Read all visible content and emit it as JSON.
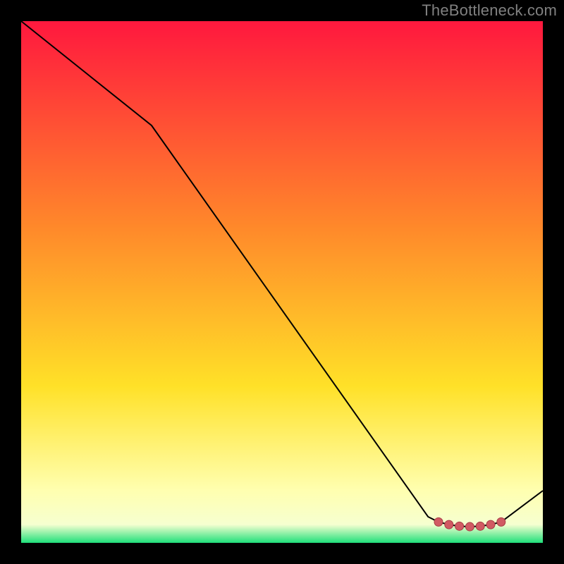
{
  "watermark": "TheBottleneck.com",
  "colors": {
    "page_bg": "#000000",
    "watermark": "#808080",
    "line": "#000000",
    "marker_fill": "#d15a63",
    "marker_stroke": "#a83c45",
    "grad_top": "#ff183e",
    "grad_mid_upper": "#ff8a2a",
    "grad_mid": "#ffe128",
    "grad_low": "#ffffb0",
    "grad_bottom": "#1fe07a"
  },
  "chart_data": {
    "type": "line",
    "title": "",
    "xlabel": "",
    "ylabel": "",
    "xlim": [
      0,
      100
    ],
    "ylim": [
      0,
      100
    ],
    "grid": false,
    "legend": false,
    "series": [
      {
        "name": "curve",
        "x": [
          0,
          25,
          78,
          80,
          82,
          84,
          86,
          88,
          90,
          92,
          100
        ],
        "y": [
          100,
          80,
          5,
          4,
          3.5,
          3.2,
          3.1,
          3.2,
          3.5,
          4,
          10
        ],
        "marker": [
          false,
          false,
          false,
          true,
          true,
          true,
          true,
          true,
          true,
          true,
          false
        ]
      }
    ],
    "gradient_stops": [
      {
        "offset": 0.0,
        "color": "#ff183e"
      },
      {
        "offset": 0.4,
        "color": "#ff8a2a"
      },
      {
        "offset": 0.7,
        "color": "#ffe128"
      },
      {
        "offset": 0.9,
        "color": "#ffffb0"
      },
      {
        "offset": 0.965,
        "color": "#f6ffd0"
      },
      {
        "offset": 1.0,
        "color": "#1fe07a"
      }
    ]
  }
}
